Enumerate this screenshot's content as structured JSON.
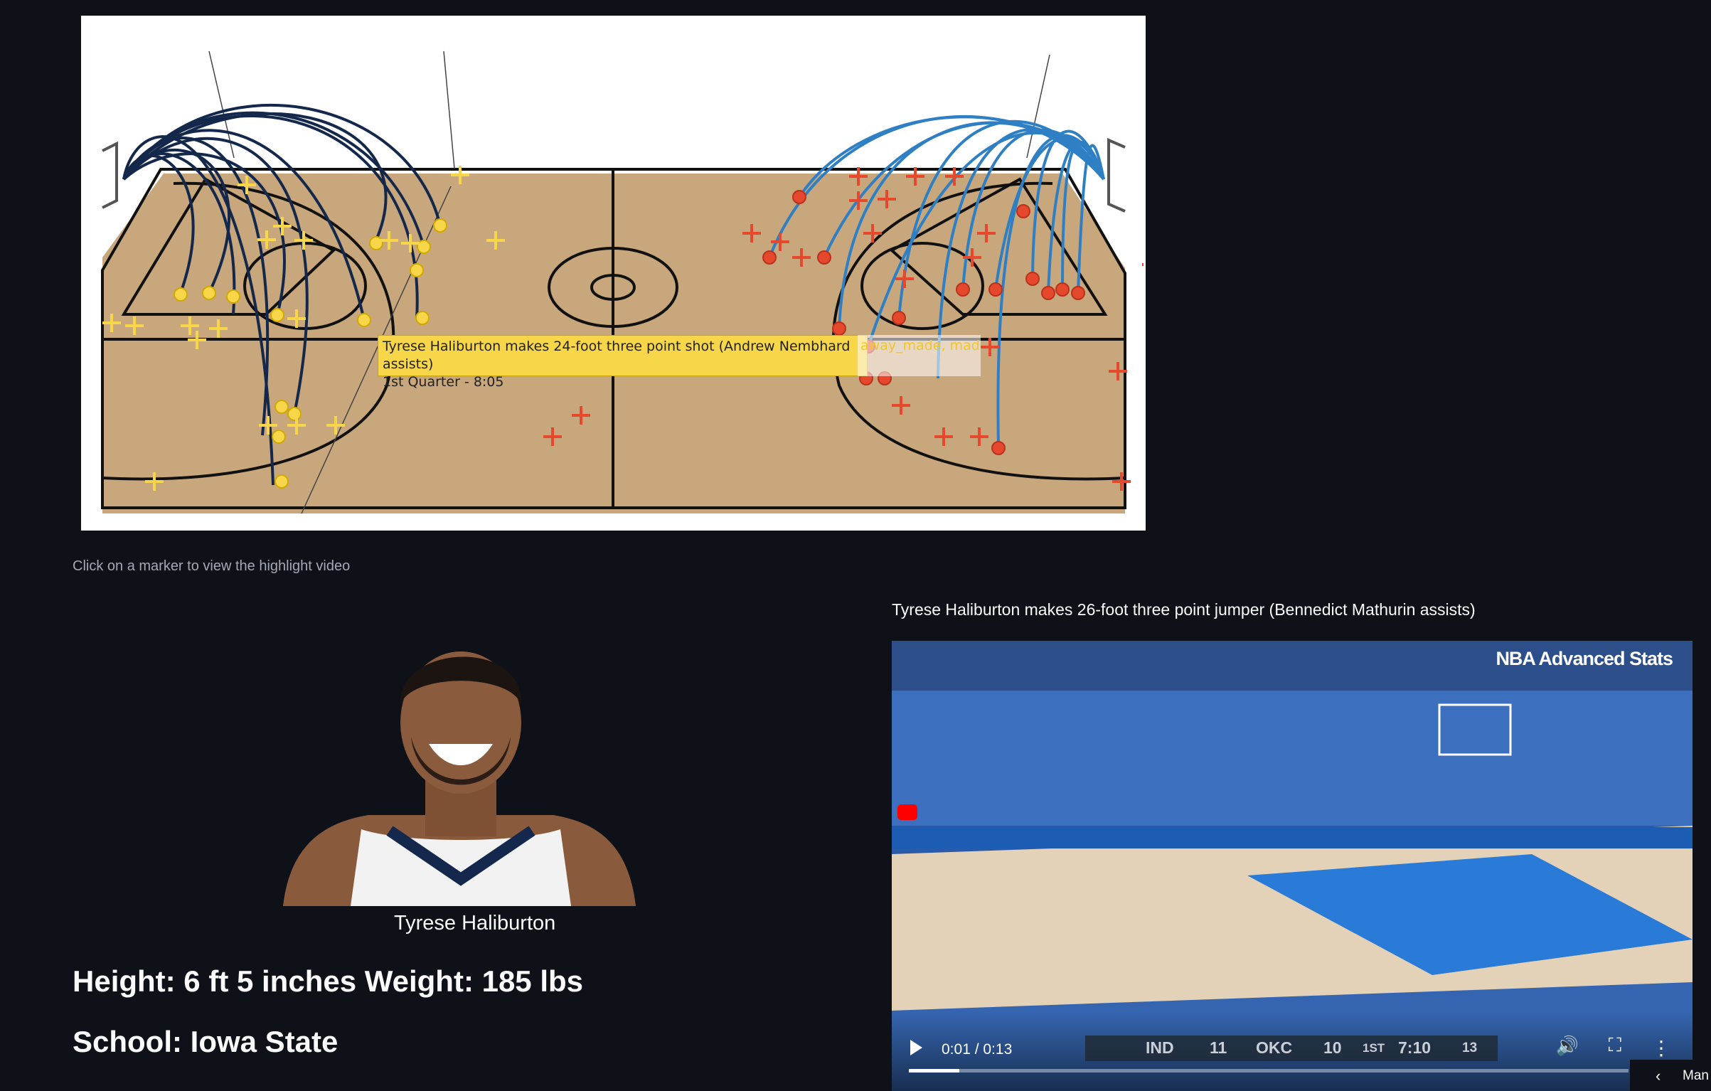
{
  "court": {
    "tooltip_line1": "Tyrese Haliburton makes 24-foot three point shot (Andrew Nembhard assists)",
    "tooltip_line2": "1st Quarter - 8:05",
    "tooltip_overflow": "away_made, made",
    "colors": {
      "court": "#c9a77c",
      "home_marker": "#f7d64a",
      "away_marker": "#e5482d",
      "home_arc": "#14284b",
      "away_arc": "#2f7fc4"
    }
  },
  "hint": "Click on a marker to view the highlight video",
  "video": {
    "title": "Tyrese Haliburton makes 26-foot three point jumper (Bennedict Mathurin assists)",
    "watermark": "NBA Advanced Stats",
    "time": "0:01 / 0:13",
    "progress": 0.07,
    "score": {
      "home": "IND",
      "home_score": "11",
      "away": "OKC",
      "away_score": "10",
      "quarter": "1ST",
      "clock": "7:10",
      "shot_clock": "13"
    }
  },
  "player": {
    "name": "Tyrese Haliburton",
    "height_weight": "Height: 6 ft 5 inches Weight: 185 lbs",
    "school": "School: Iowa State"
  },
  "sidebar_toggle": "Man"
}
